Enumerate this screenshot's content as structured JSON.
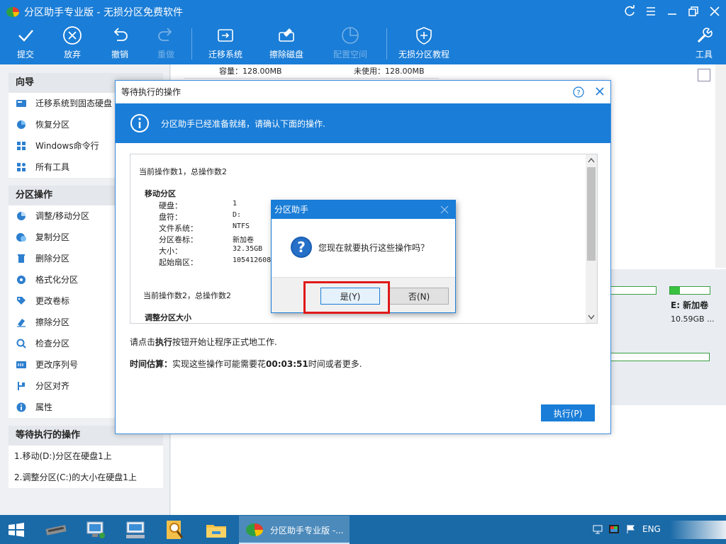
{
  "app": {
    "title": "分区助手专业版 - 无损分区免费软件"
  },
  "toolbar": {
    "commit": "提交",
    "discard": "放弃",
    "undo": "撤销",
    "redo": "重做",
    "migrate_os": "迁移系统",
    "wipe_disk": "擦除磁盘",
    "allocate_space": "配置空间",
    "tutorial": "无损分区教程",
    "tools": "工具"
  },
  "sidebar": {
    "wizard_title": "向导",
    "wizard_items": [
      {
        "label": "迁移系统到固态硬盘",
        "icon": "migrate-ssd-icon"
      },
      {
        "label": "恢复分区",
        "icon": "restore-partition-icon"
      },
      {
        "label": "Windows命令行",
        "icon": "windows-icon"
      },
      {
        "label": "所有工具",
        "icon": "grid-icon"
      }
    ],
    "ops_title": "分区操作",
    "ops_items": [
      {
        "label": "调整/移动分区",
        "icon": "resize-icon"
      },
      {
        "label": "复制分区",
        "icon": "copy-icon"
      },
      {
        "label": "删除分区",
        "icon": "delete-icon"
      },
      {
        "label": "格式化分区",
        "icon": "format-icon"
      },
      {
        "label": "更改卷标",
        "icon": "tag-icon"
      },
      {
        "label": "擦除分区",
        "icon": "eraser-icon"
      },
      {
        "label": "检查分区",
        "icon": "magnifier-icon"
      },
      {
        "label": "更改序列号",
        "icon": "serial-icon"
      },
      {
        "label": "分区对齐",
        "icon": "align-icon"
      },
      {
        "label": "属性",
        "icon": "info-icon"
      }
    ],
    "pending_title": "等待执行的操作",
    "pending_items": [
      "1.移动(D:)分区在硬盘1上",
      "2.调整分区(C:)的大小在硬盘1上"
    ]
  },
  "main": {
    "capacity": "容量：128.00MB",
    "unused": "未使用：128.00MB",
    "disk_e_label": "E: 新加卷",
    "disk_e_size": "10.59GB ..."
  },
  "pending_dialog": {
    "title": "等待执行的操作",
    "banner": "分区助手已经准备就绪，请确认下面的操作.",
    "op1_header": "当前操作数1，总操作数2",
    "op1_title": "移动分区",
    "op1_fields": [
      {
        "key": "硬盘：",
        "value": "1"
      },
      {
        "key": "盘符：",
        "value": "D:"
      },
      {
        "key": "文件系统：",
        "value": "NTFS"
      },
      {
        "key": "分区卷标：",
        "value": "新加卷"
      },
      {
        "key": "大小：",
        "value": "32.35GB"
      },
      {
        "key": "起始扇区：",
        "value": "105412608"
      }
    ],
    "op2_header": "当前操作数2，总操作数2",
    "op2_title": "调整分区大小",
    "hint_prefix": "请点击",
    "hint_bold": "执行",
    "hint_suffix": "按钮开始让程序正式地工作.",
    "estimate_label": "时间估算：",
    "estimate_prefix": "实现这些操作可能需要花",
    "estimate_time": "00:03:51",
    "estimate_suffix": "时间或者更多.",
    "execute_button": "执行(P)"
  },
  "confirm_dialog": {
    "title": "分区助手",
    "message": "您现在就要执行这些操作吗？",
    "yes": "是(Y)",
    "no": "否(N)"
  },
  "taskbar": {
    "active_task": "分区助手专业版 -...",
    "lang": "ENG"
  }
}
